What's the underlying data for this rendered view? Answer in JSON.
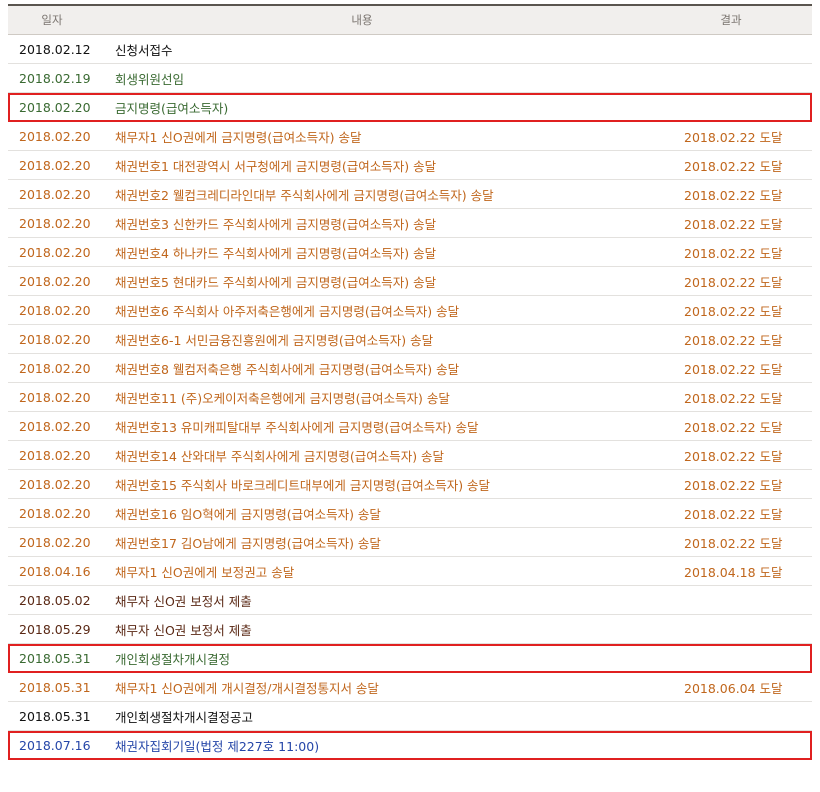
{
  "table": {
    "headers": {
      "date": "일자",
      "content": "내용",
      "result": "결과"
    },
    "rows": [
      {
        "date": "2018.02.12",
        "content": "신청서접수",
        "result": "",
        "style": "black",
        "highlight": false
      },
      {
        "date": "2018.02.19",
        "content": "회생위원선임",
        "result": "",
        "style": "green",
        "highlight": false
      },
      {
        "date": "2018.02.20",
        "content": "금지명령(급여소득자)",
        "result": "",
        "style": "green",
        "highlight": true
      },
      {
        "date": "2018.02.20",
        "content": "채무자1 신O권에게 금지명령(급여소득자) 송달",
        "result": "2018.02.22 도달",
        "style": "orange",
        "highlight": false
      },
      {
        "date": "2018.02.20",
        "content": "채권번호1 대전광역시 서구청에게 금지명령(급여소득자) 송달",
        "result": "2018.02.22 도달",
        "style": "orange",
        "highlight": false
      },
      {
        "date": "2018.02.20",
        "content": "채권번호2 웰컴크레디라인대부 주식회사에게 금지명령(급여소득자) 송달",
        "result": "2018.02.22 도달",
        "style": "orange",
        "highlight": false
      },
      {
        "date": "2018.02.20",
        "content": "채권번호3 신한카드 주식회사에게 금지명령(급여소득자) 송달",
        "result": "2018.02.22 도달",
        "style": "orange",
        "highlight": false
      },
      {
        "date": "2018.02.20",
        "content": "채권번호4 하나카드 주식회사에게 금지명령(급여소득자) 송달",
        "result": "2018.02.22 도달",
        "style": "orange",
        "highlight": false
      },
      {
        "date": "2018.02.20",
        "content": "채권번호5 현대카드 주식회사에게 금지명령(급여소득자) 송달",
        "result": "2018.02.22 도달",
        "style": "orange",
        "highlight": false
      },
      {
        "date": "2018.02.20",
        "content": "채권번호6 주식회사 아주저축은행에게 금지명령(급여소득자) 송달",
        "result": "2018.02.22 도달",
        "style": "orange",
        "highlight": false
      },
      {
        "date": "2018.02.20",
        "content": "채권번호6-1 서민금융진흥원에게 금지명령(급여소득자) 송달",
        "result": "2018.02.22 도달",
        "style": "orange",
        "highlight": false
      },
      {
        "date": "2018.02.20",
        "content": "채권번호8 웰컴저축은행 주식회사에게 금지명령(급여소득자) 송달",
        "result": "2018.02.22 도달",
        "style": "orange",
        "highlight": false
      },
      {
        "date": "2018.02.20",
        "content": "채권번호11 (주)오케이저축은행에게 금지명령(급여소득자) 송달",
        "result": "2018.02.22 도달",
        "style": "orange",
        "highlight": false
      },
      {
        "date": "2018.02.20",
        "content": "채권번호13 유미캐피탈대부 주식회사에게 금지명령(급여소득자) 송달",
        "result": "2018.02.22 도달",
        "style": "orange",
        "highlight": false
      },
      {
        "date": "2018.02.20",
        "content": "채권번호14 산와대부 주식회사에게 금지명령(급여소득자) 송달",
        "result": "2018.02.22 도달",
        "style": "orange",
        "highlight": false
      },
      {
        "date": "2018.02.20",
        "content": "채권번호15 주식회사 바로크레디트대부에게 금지명령(급여소득자) 송달",
        "result": "2018.02.22 도달",
        "style": "orange",
        "highlight": false
      },
      {
        "date": "2018.02.20",
        "content": "채권번호16 임O혁에게 금지명령(급여소득자) 송달",
        "result": "2018.02.22 도달",
        "style": "orange",
        "highlight": false
      },
      {
        "date": "2018.02.20",
        "content": "채권번호17 김O남에게 금지명령(급여소득자) 송달",
        "result": "2018.02.22 도달",
        "style": "orange",
        "highlight": false
      },
      {
        "date": "2018.04.16",
        "content": "채무자1 신O권에게 보정권고 송달",
        "result": "2018.04.18 도달",
        "style": "orange",
        "highlight": false
      },
      {
        "date": "2018.05.02",
        "content": "채무자 신O권 보정서 제출",
        "result": "",
        "style": "brown",
        "highlight": false
      },
      {
        "date": "2018.05.29",
        "content": "채무자 신O권 보정서 제출",
        "result": "",
        "style": "brown",
        "highlight": false
      },
      {
        "date": "2018.05.31",
        "content": "개인회생절차개시결정",
        "result": "",
        "style": "green",
        "highlight": true
      },
      {
        "date": "2018.05.31",
        "content": "채무자1 신O권에게 개시결정/개시결정통지서 송달",
        "result": "2018.06.04 도달",
        "style": "orange",
        "highlight": false
      },
      {
        "date": "2018.05.31",
        "content": "개인회생절차개시결정공고",
        "result": "",
        "style": "black",
        "highlight": false
      },
      {
        "date": "2018.07.16",
        "content": "채권자집회기일(법정 제227호 11:00)",
        "result": "",
        "style": "blue",
        "highlight": true
      }
    ]
  },
  "colors": {
    "black": "#111111",
    "green": "#3a6a32",
    "orange": "#c0661c",
    "brown": "#5a2814",
    "blue": "#2546a8",
    "highlight_border": "#e02020"
  }
}
